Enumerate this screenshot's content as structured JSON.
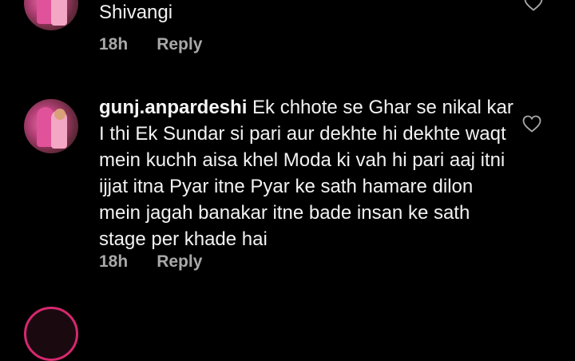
{
  "comments": [
    {
      "username": "",
      "text": "Shivangi",
      "time": "18h",
      "reply_label": "Reply"
    },
    {
      "username": "gunj.anpardeshi",
      "text": "Ek chhote se Ghar se nikal kar I thi Ek Sundar si pari aur dekhte hi dekhte waqt mein kuchh aisa khel Moda ki vah hi pari aaj itni ijjat itna Pyar itne Pyar ke sath hamare dilon mein jagah banakar itne bade insan ke sath stage per khade hai",
      "time": "18h",
      "reply_label": "Reply"
    }
  ],
  "colors": {
    "background": "#000000",
    "text": "#f2f2f2",
    "meta": "#a8a8a8",
    "story_ring": "#d6286e"
  },
  "icons": {
    "like": "heart-outline-icon"
  }
}
